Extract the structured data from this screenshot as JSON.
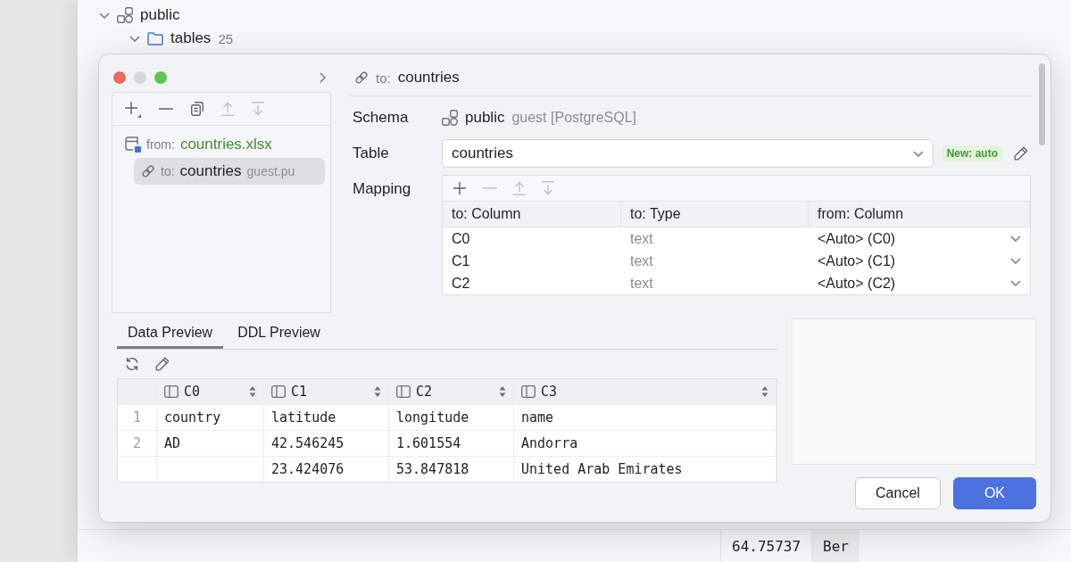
{
  "background": {
    "tree": [
      {
        "label": "public",
        "kind": "schema",
        "expanded": true,
        "children": [
          {
            "label": "tables",
            "count": "25",
            "kind": "folder",
            "expanded": true
          }
        ]
      }
    ],
    "grid_cells": [
      "64.75737",
      "Ber"
    ]
  },
  "dialog": {
    "window_controls": [
      {
        "kind": "close",
        "disabled": false
      },
      {
        "kind": "minimize",
        "disabled": true
      },
      {
        "kind": "zoom",
        "disabled": false
      }
    ],
    "sidebar": {
      "toolbar": [
        {
          "kind": "add_menu",
          "disabled": false
        },
        {
          "kind": "remove",
          "disabled": false
        },
        {
          "kind": "copy",
          "disabled": false
        },
        {
          "kind": "up",
          "disabled": true
        },
        {
          "kind": "down",
          "disabled": true
        }
      ],
      "items": [
        {
          "kind": "file",
          "prefix": "from:",
          "label": "countries.xlsx",
          "selected": false,
          "children": [
            {
              "kind": "link",
              "prefix": "to:",
              "label": "countries",
              "detail": "guest.pu",
              "selected": true
            }
          ]
        }
      ]
    },
    "header": {
      "prefix": "to:",
      "label": "countries"
    },
    "form": {
      "schema": {
        "label": "Schema",
        "value": "public",
        "detail": "guest [PostgreSQL]"
      },
      "table": {
        "label": "Table",
        "value": "countries",
        "badge": "New: auto"
      },
      "mapping": {
        "label": "Mapping",
        "toolbar": [
          {
            "kind": "add",
            "disabled": false
          },
          {
            "kind": "remove",
            "disabled": true
          },
          {
            "kind": "up",
            "disabled": true
          },
          {
            "kind": "down",
            "disabled": true
          }
        ],
        "columns": [
          "to: Column",
          "to: Type",
          "from: Column"
        ],
        "rows": [
          {
            "column": "C0",
            "type": "text",
            "source": "<Auto> (C0)"
          },
          {
            "column": "C1",
            "type": "text",
            "source": "<Auto> (C1)"
          },
          {
            "column": "C2",
            "type": "text",
            "source": "<Auto> (C2)"
          }
        ]
      }
    },
    "preview": {
      "tabs": [
        {
          "label": "Data Preview",
          "selected": true
        },
        {
          "label": "DDL Preview",
          "selected": false
        }
      ],
      "columns": [
        "C0",
        "C1",
        "C2",
        "C3"
      ],
      "rows": [
        {
          "number": "1",
          "cells": [
            "country",
            "latitude",
            "longitude",
            "name"
          ]
        },
        {
          "number": "2",
          "cells": [
            "AD",
            "42.546245",
            "1.601554",
            "Andorra"
          ]
        },
        {
          "cells": [
            null,
            "23.424076",
            "53.847818",
            "United Arab Emirates"
          ]
        }
      ]
    },
    "buttons": [
      {
        "label": "Cancel",
        "kind": "cancel"
      },
      {
        "label": "OK",
        "kind": "confirm"
      }
    ]
  }
}
